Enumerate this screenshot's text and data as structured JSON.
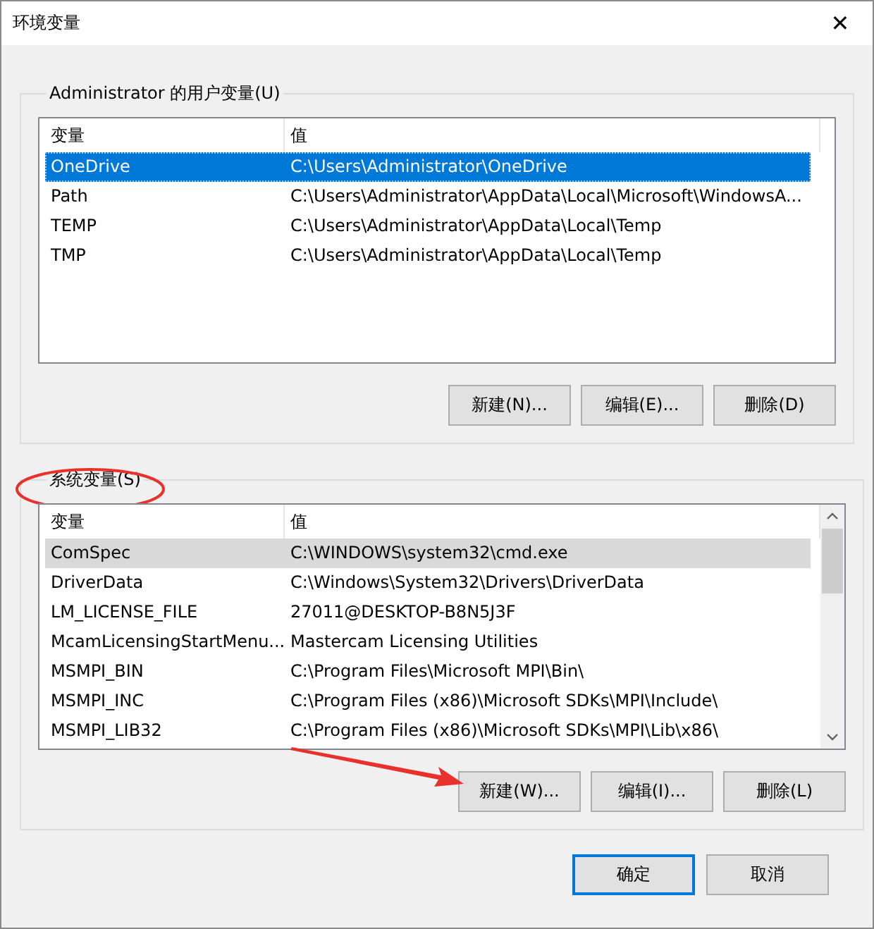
{
  "window": {
    "title": "环境变量",
    "close": "✕"
  },
  "groups": [
    {
      "label": "Administrator 的用户变量(U)",
      "focused": true,
      "scrollbar": false,
      "columns": [
        "变量",
        "值"
      ],
      "rows": [
        {
          "name": "OneDrive",
          "value": "C:\\Users\\Administrator\\OneDrive",
          "selected": true
        },
        {
          "name": "Path",
          "value": "C:\\Users\\Administrator\\AppData\\Local\\Microsoft\\WindowsA...",
          "selected": false
        },
        {
          "name": "TEMP",
          "value": "C:\\Users\\Administrator\\AppData\\Local\\Temp",
          "selected": false
        },
        {
          "name": "TMP",
          "value": "C:\\Users\\Administrator\\AppData\\Local\\Temp",
          "selected": false
        }
      ],
      "buttons": [
        "新建(N)...",
        "编辑(E)...",
        "删除(D)"
      ],
      "annotated": false
    },
    {
      "label": "系统变量(S)",
      "focused": false,
      "scrollbar": true,
      "columns": [
        "变量",
        "值"
      ],
      "rows": [
        {
          "name": "ComSpec",
          "value": "C:\\WINDOWS\\system32\\cmd.exe",
          "selected": true
        },
        {
          "name": "DriverData",
          "value": "C:\\Windows\\System32\\Drivers\\DriverData",
          "selected": false
        },
        {
          "name": "LM_LICENSE_FILE",
          "value": "27011@DESKTOP-B8N5J3F",
          "selected": false
        },
        {
          "name": "McamLicensingStartMenu...",
          "value": "Mastercam Licensing Utilities",
          "selected": false
        },
        {
          "name": "MSMPI_BIN",
          "value": "C:\\Program Files\\Microsoft MPI\\Bin\\",
          "selected": false
        },
        {
          "name": "MSMPI_INC",
          "value": "C:\\Program Files (x86)\\Microsoft SDKs\\MPI\\Include\\",
          "selected": false
        },
        {
          "name": "MSMPI_LIB32",
          "value": "C:\\Program Files (x86)\\Microsoft SDKs\\MPI\\Lib\\x86\\",
          "selected": false
        }
      ],
      "buttons": [
        "新建(W)...",
        "编辑(I)...",
        "删除(L)"
      ],
      "annotated": true
    }
  ],
  "footer_buttons": [
    {
      "label": "确定",
      "default": true
    },
    {
      "label": "取消",
      "default": false
    }
  ]
}
